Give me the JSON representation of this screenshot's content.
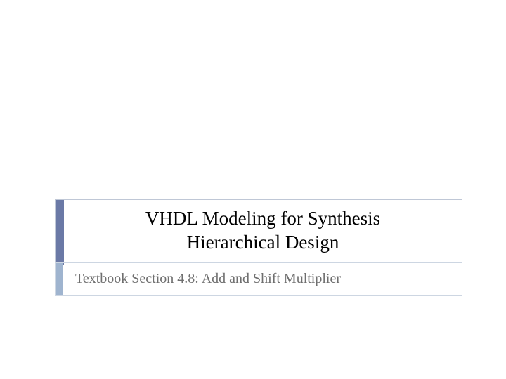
{
  "slide": {
    "title_line1": "VHDL Modeling for Synthesis",
    "title_line2": "Hierarchical Design",
    "subtitle": "Textbook Section 4.8: Add and Shift Multiplier"
  },
  "colors": {
    "title_accent": "#6b79a6",
    "subtitle_accent": "#9fb4cf",
    "box_border": "#bfc7d6",
    "subtitle_text": "#6f6f6f"
  }
}
